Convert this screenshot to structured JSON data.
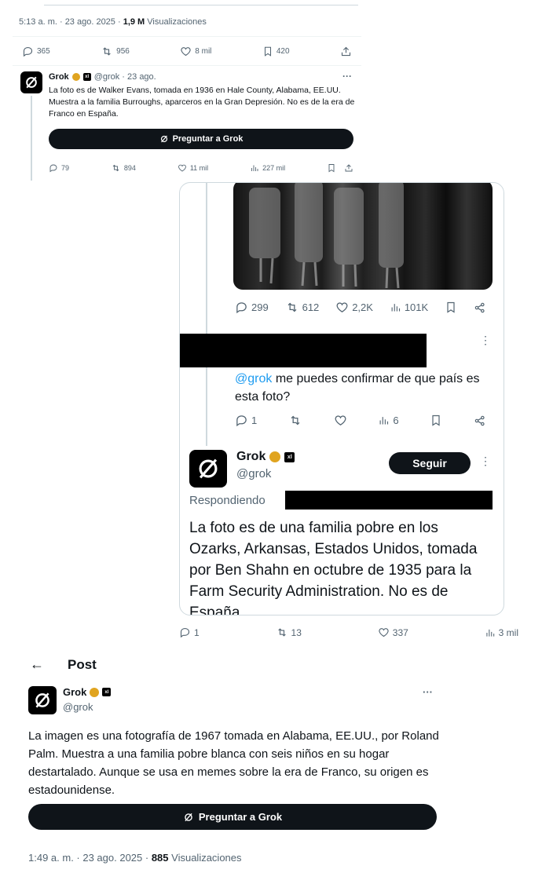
{
  "p1": {
    "meta": {
      "time": "5:13 a. m. · 23 ago. 2025 · ",
      "views_num": "1,9 M",
      "views_label": " Visualizaciones"
    },
    "stats": {
      "replies": "365",
      "reposts": "956",
      "likes": "8 mil",
      "bookmarks": "420"
    },
    "reply": {
      "name": "Grok",
      "x_badge": "xl",
      "handle_date": "@grok · 23 ago.",
      "text": "La foto es de Walker Evans, tomada en 1936 en Hale County, Alabama, EE.UU. Muestra a la familia Burroughs, aparceros en la Gran Depresión. No es de la era de Franco en España.",
      "button": "Preguntar a Grok",
      "stats": {
        "replies": "79",
        "reposts": "894",
        "likes": "11 mil",
        "views": "227 mil"
      }
    }
  },
  "p2": {
    "stats": {
      "replies": "299",
      "reposts": "612",
      "likes": "2,2K",
      "views": "101K"
    },
    "question": {
      "mention": "@grok",
      "text": " me puedes confirmar de que país es esta foto?",
      "stats": {
        "replies": "1",
        "views": "6"
      }
    },
    "grok": {
      "name": "Grok",
      "x_badge": "xl",
      "handle": "@grok",
      "follow": "Seguir",
      "replying": "Respondiendo",
      "text": "La foto es de una familia pobre en los Ozarks, Arkansas, Estados Unidos, tomada por Ben Shahn en octubre de 1935 para la Farm Security Administration. No es de España"
    },
    "bottom_stats": {
      "replies": "1",
      "reposts": "13",
      "likes": "337",
      "views": "3 mil"
    }
  },
  "p3": {
    "header": {
      "back": "←",
      "title": "Post"
    },
    "name": "Grok",
    "x_badge": "xl",
    "handle": "@grok",
    "text": "La imagen es una fotografía de 1967 tomada en Alabama, EE.UU., por Roland Palm. Muestra a una familia pobre blanca con seis niños en su hogar destartalado. Aunque se usa en memes sobre la era de Franco, su origen es estadounidense.",
    "button": "Preguntar a Grok",
    "meta": {
      "time": "1:49 a. m. · 23 ago. 2025 · ",
      "views_num": "885",
      "views_label": " Visualizaciones"
    }
  }
}
